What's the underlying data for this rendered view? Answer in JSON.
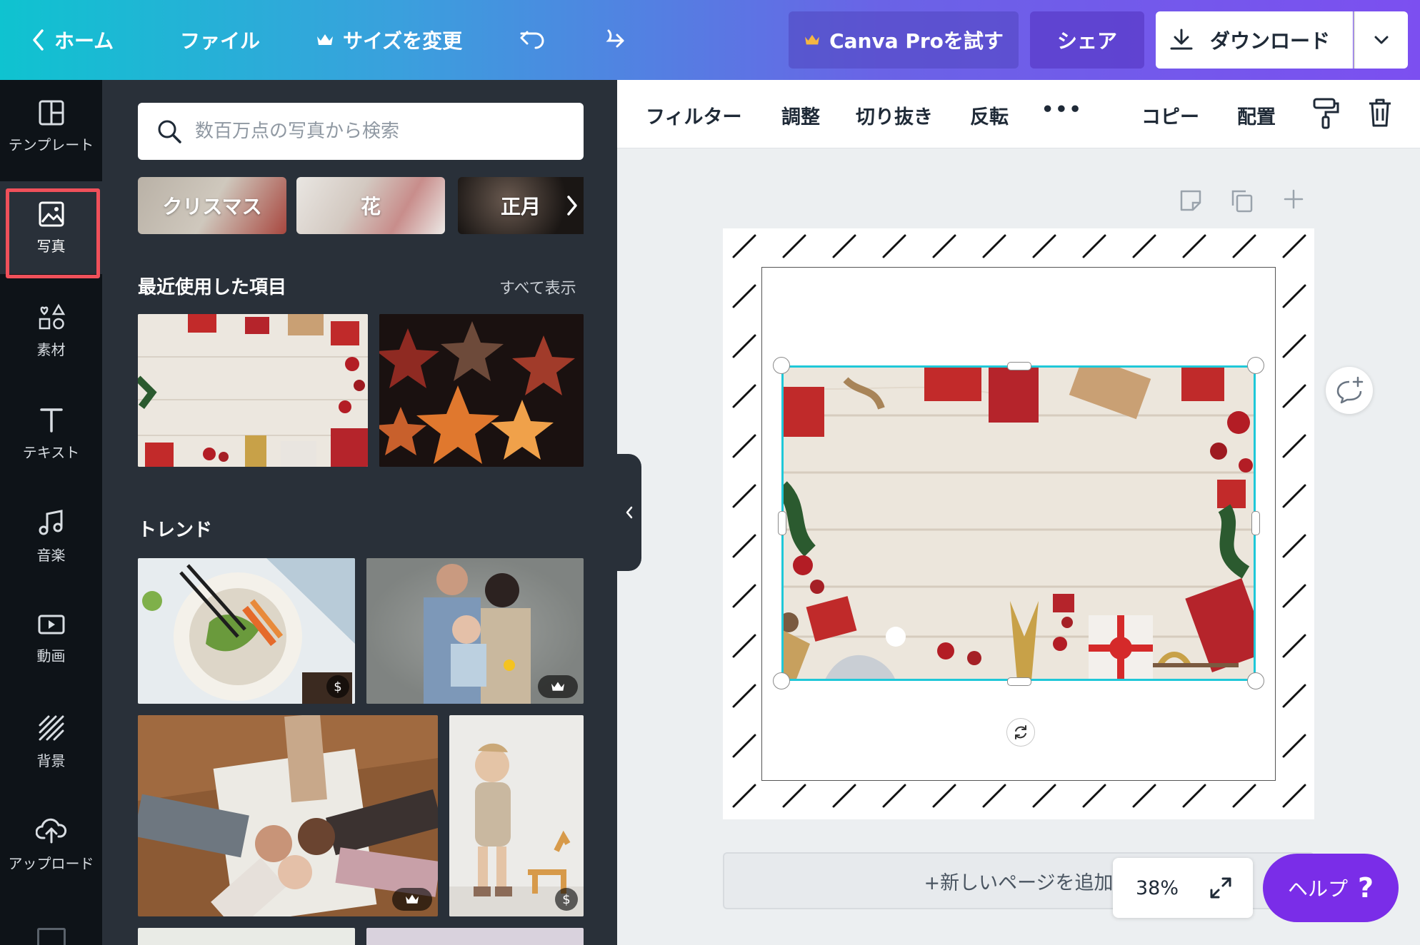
{
  "topbar": {
    "home": "ホーム",
    "file": "ファイル",
    "resize": "サイズを変更",
    "pro": "Canva Proを試す",
    "share": "シェア",
    "download": "ダウンロード"
  },
  "rail": {
    "items": [
      {
        "label": "テンプレート",
        "icon": "template-icon"
      },
      {
        "label": "写真",
        "icon": "photo-icon"
      },
      {
        "label": "素材",
        "icon": "elements-icon"
      },
      {
        "label": "テキスト",
        "icon": "text-icon"
      },
      {
        "label": "音楽",
        "icon": "music-icon"
      },
      {
        "label": "動画",
        "icon": "video-icon"
      },
      {
        "label": "背景",
        "icon": "background-icon"
      },
      {
        "label": "アップロード",
        "icon": "upload-icon"
      }
    ]
  },
  "panel": {
    "search_placeholder": "数百万点の写真から検索",
    "chips": [
      "クリスマス",
      "花",
      "正月"
    ],
    "recent_title": "最近使用した項目",
    "see_all": "すべて表示",
    "trend_title": "トレンド",
    "badges": {
      "dollar": "$"
    }
  },
  "toolbar": {
    "filter": "フィルター",
    "adjust": "調整",
    "crop": "切り抜き",
    "flip": "反転",
    "more": "•••",
    "copy": "コピー",
    "position": "配置"
  },
  "canvas": {
    "add_page": "+新しいページを追加",
    "zoom": "38%"
  },
  "help": {
    "label": "ヘルプ",
    "mark": "?"
  },
  "colors": {
    "accent": "#1fc8d8",
    "highlight": "#f0505a",
    "help": "#7a2de8"
  }
}
